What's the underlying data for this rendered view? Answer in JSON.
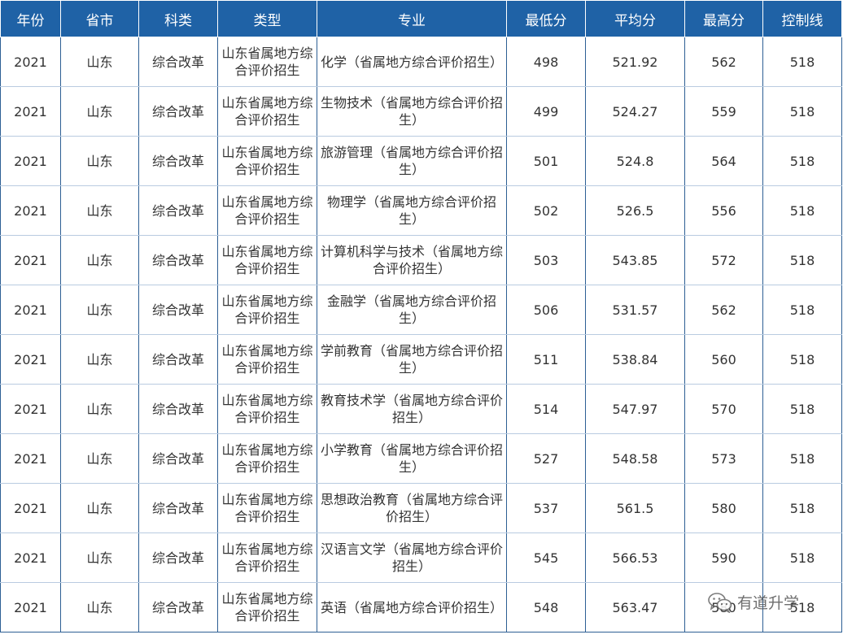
{
  "table": {
    "headers": [
      "年份",
      "省市",
      "科类",
      "类型",
      "专业",
      "最低分",
      "平均分",
      "最高分",
      "控制线"
    ],
    "rows": [
      [
        "2021",
        "山东",
        "综合改革",
        "山东省属地方综合评价招生",
        "化学（省属地方综合评价招生）",
        "498",
        "521.92",
        "562",
        "518"
      ],
      [
        "2021",
        "山东",
        "综合改革",
        "山东省属地方综合评价招生",
        "生物技术（省属地方综合评价招生）",
        "499",
        "524.27",
        "559",
        "518"
      ],
      [
        "2021",
        "山东",
        "综合改革",
        "山东省属地方综合评价招生",
        "旅游管理（省属地方综合评价招生）",
        "501",
        "524.8",
        "564",
        "518"
      ],
      [
        "2021",
        "山东",
        "综合改革",
        "山东省属地方综合评价招生",
        "物理学（省属地方综合评价招生）",
        "502",
        "526.5",
        "556",
        "518"
      ],
      [
        "2021",
        "山东",
        "综合改革",
        "山东省属地方综合评价招生",
        "计算机科学与技术（省属地方综合评价招生）",
        "503",
        "543.85",
        "572",
        "518"
      ],
      [
        "2021",
        "山东",
        "综合改革",
        "山东省属地方综合评价招生",
        "金融学（省属地方综合评价招生）",
        "506",
        "531.57",
        "562",
        "518"
      ],
      [
        "2021",
        "山东",
        "综合改革",
        "山东省属地方综合评价招生",
        "学前教育（省属地方综合评价招生）",
        "511",
        "538.84",
        "560",
        "518"
      ],
      [
        "2021",
        "山东",
        "综合改革",
        "山东省属地方综合评价招生",
        "教育技术学（省属地方综合评价招生）",
        "514",
        "547.97",
        "570",
        "518"
      ],
      [
        "2021",
        "山东",
        "综合改革",
        "山东省属地方综合评价招生",
        "小学教育（省属地方综合评价招生）",
        "527",
        "548.58",
        "573",
        "518"
      ],
      [
        "2021",
        "山东",
        "综合改革",
        "山东省属地方综合评价招生",
        "思想政治教育（省属地方综合评价招生）",
        "537",
        "561.5",
        "580",
        "518"
      ],
      [
        "2021",
        "山东",
        "综合改革",
        "山东省属地方综合评价招生",
        "汉语言文学（省属地方综合评价招生）",
        "545",
        "566.53",
        "590",
        "518"
      ],
      [
        "2021",
        "山东",
        "综合改革",
        "山东省属地方综合评价招生",
        "英语（省属地方综合评价招生）",
        "548",
        "563.47",
        "580",
        "518"
      ]
    ]
  },
  "watermark": {
    "text": "有道升学",
    "icon": "wechat-icon"
  },
  "colors": {
    "header_bg": "#1f62a6",
    "header_text": "#ffffff",
    "border": "#2d5f94",
    "row_divider": "#b9cbe0",
    "body_text": "#333333"
  }
}
